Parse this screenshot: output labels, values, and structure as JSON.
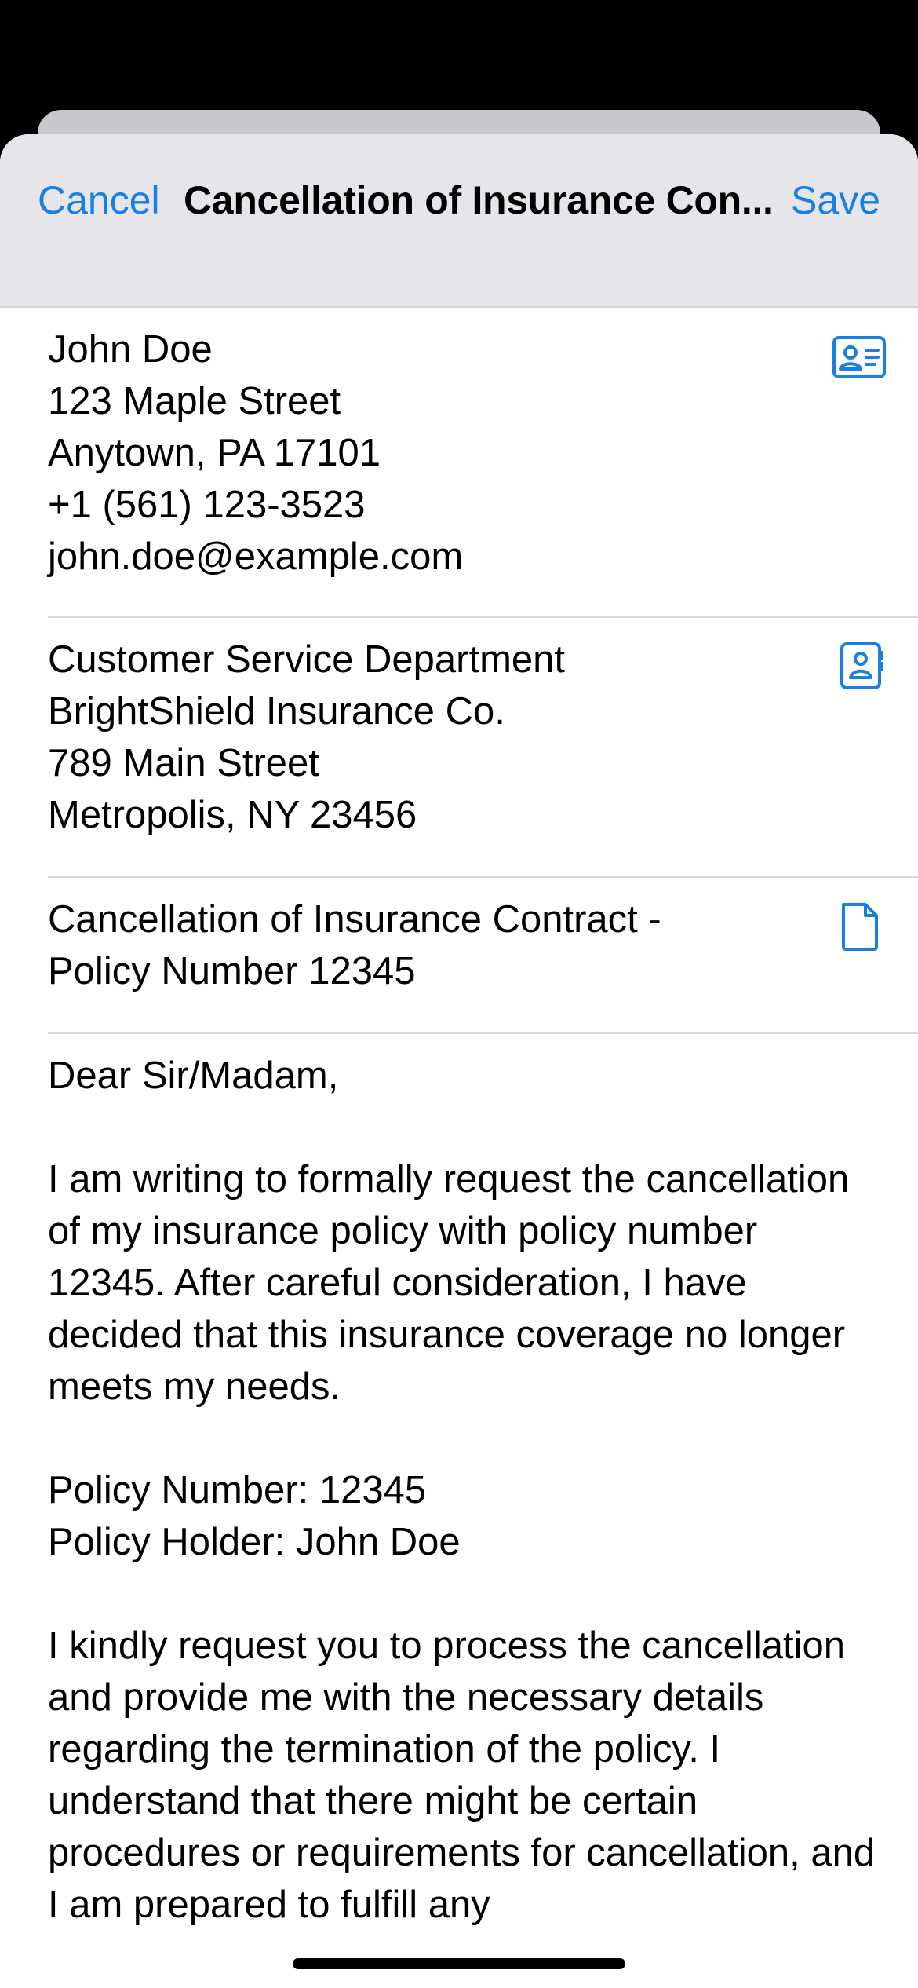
{
  "nav": {
    "cancel_label": "Cancel",
    "title": "Cancellation of Insurance Con...",
    "save_label": "Save"
  },
  "sender": {
    "lines": [
      "John Doe",
      "123 Maple Street",
      "Anytown, PA 17101",
      "+1 (561) 123-3523",
      "john.doe@example.com"
    ],
    "icon": "contact-card-icon"
  },
  "recipient": {
    "lines": [
      "Customer Service Department",
      "BrightShield Insurance Co.",
      "789 Main Street",
      "Metropolis, NY 23456"
    ],
    "icon": "address-book-icon"
  },
  "subject": {
    "lines": [
      "Cancellation of Insurance Contract -",
      "Policy Number 12345"
    ],
    "icon": "document-icon"
  },
  "letter": {
    "greeting": "Dear Sir/Madam,",
    "paragraph1": "I am writing to formally request the cancellation of my insurance policy with policy number 12345. After careful consideration, I have decided that this insurance coverage no longer meets my needs.",
    "policy_number": "Policy Number: 12345",
    "policy_holder": "Policy Holder: John Doe",
    "paragraph2": "I kindly request you to process the cancellation and provide me with the necessary details regarding the termination of the policy. I understand that there might be certain procedures or requirements for cancellation, and I am prepared to fulfill any"
  },
  "colors": {
    "accent": "#1a7fe3",
    "nav_background": "#e5e5ea"
  }
}
